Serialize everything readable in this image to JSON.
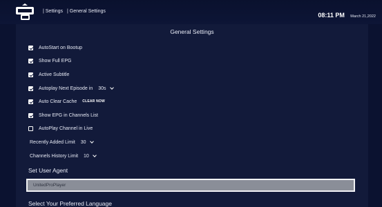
{
  "header": {
    "logo_icon": "united-pro-logo-icon",
    "breadcrumb": [
      "| Settings",
      "| General Settings"
    ],
    "time": "08:11 PM",
    "date": "March 21,2022"
  },
  "panel": {
    "title": "General Settings",
    "options": [
      {
        "label": "AutoStart on Bootup",
        "checked": true
      },
      {
        "label": "Show Full EPG",
        "checked": true
      },
      {
        "label": "Active Subtitle",
        "checked": true
      },
      {
        "label": "Autoplay Next Episode in",
        "checked": true,
        "value": "30s"
      },
      {
        "label": "Auto Clear Cache",
        "checked": true,
        "action": "CLEAR NOW"
      },
      {
        "label": "Show EPG in Channels List",
        "checked": true
      },
      {
        "label": "AutoPlay Channel in Live",
        "checked": false
      }
    ],
    "recently_added": {
      "label": "Recently Added Limit",
      "value": "30"
    },
    "channels_history": {
      "label": "Channels History Limit",
      "value": "10"
    },
    "user_agent": {
      "label": "Set User Agent",
      "value": "UnitedProPlayer"
    },
    "language": {
      "label": "Select Your Preferred Language"
    }
  },
  "colors": {
    "background": "#0b1230",
    "panel": "#121a3a",
    "input": "#8a8e98",
    "text": "#e6e9f4"
  }
}
